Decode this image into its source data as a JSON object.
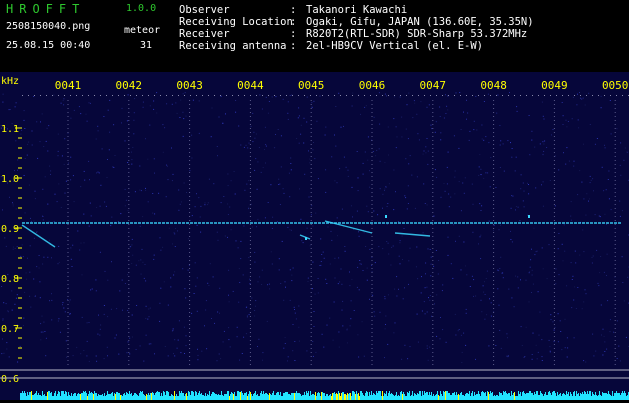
{
  "app": {
    "name": "HROFFT",
    "version": "1.0.0"
  },
  "file": {
    "name": "2508150040.png",
    "timestamp": "25.08.15 00:40"
  },
  "meteor": {
    "label": "meteor",
    "count": "31"
  },
  "info": [
    {
      "label": "Observer",
      "value": "Takanori Kawachi"
    },
    {
      "label": "Receiving Location",
      "value": "Ogaki, Gifu, JAPAN (136.60E, 35.35N)"
    },
    {
      "label": "Receiver",
      "value": "R820T2(RTL-SDR) SDR-Sharp 53.372MHz"
    },
    {
      "label": "Receiving antenna",
      "value": "2el-HB9CV Vertical (el. E-W)"
    }
  ],
  "info_separator": ":",
  "spectrogram": {
    "y_unit": "kHz",
    "y_ticks": [
      "1.1",
      "1.0",
      "0.9",
      "0.8",
      "0.7",
      "0.6"
    ],
    "x_ticks": [
      "0041",
      "0042",
      "0043",
      "0044",
      "0045",
      "0046",
      "0047",
      "0048",
      "0049",
      "0050"
    ],
    "carrier_khz": 0.91,
    "colors": {
      "background": "#06063a",
      "tick_label": "#ffff00",
      "carrier": "#3ad8ff",
      "noise_floor": "#22e4ff",
      "noise_peak": "#ffff00"
    }
  }
}
